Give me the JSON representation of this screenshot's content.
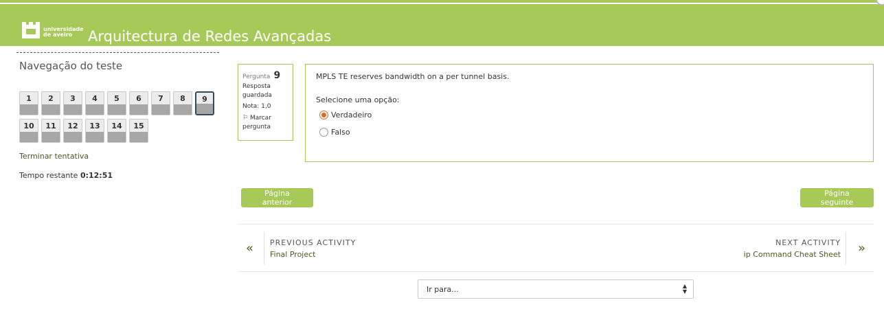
{
  "colors": {
    "brand": "#a7c957",
    "link": "#4a5b1f",
    "radio_checked": "#d86a2a",
    "current_border": "#2f4b60"
  },
  "header": {
    "logo_line1": "universidade",
    "logo_line2": "de aveiro",
    "course_title": "Arquitectura de Redes Avançadas"
  },
  "nav": {
    "title": "Navegação do teste",
    "questions": [
      "1",
      "2",
      "3",
      "4",
      "5",
      "6",
      "7",
      "8",
      "9",
      "10",
      "11",
      "12",
      "13",
      "14",
      "15"
    ],
    "current": "9",
    "finish_link": "Terminar tentativa",
    "time_label": "Tempo restante",
    "time_value": "0:12:51"
  },
  "question": {
    "label": "Pergunta",
    "number": "9",
    "state": "Resposta guardada",
    "grade": "Nota: 1,0",
    "flag": "Marcar pergunta",
    "text": "MPLS TE reserves bandwidth on a per tunnel basis.",
    "prompt": "Selecione uma opção:",
    "options": [
      {
        "label": "Verdadeiro",
        "checked": true
      },
      {
        "label": "Falso",
        "checked": false
      }
    ]
  },
  "buttons": {
    "prev": "Página anterior",
    "next": "Página seguinte"
  },
  "activity": {
    "prev_label": "PREVIOUS ACTIVITY",
    "prev_name": "Final Project",
    "next_label": "NEXT ACTIVITY",
    "next_name": "ip Command Cheat Sheet"
  },
  "jump": {
    "selected": "Ir para..."
  }
}
